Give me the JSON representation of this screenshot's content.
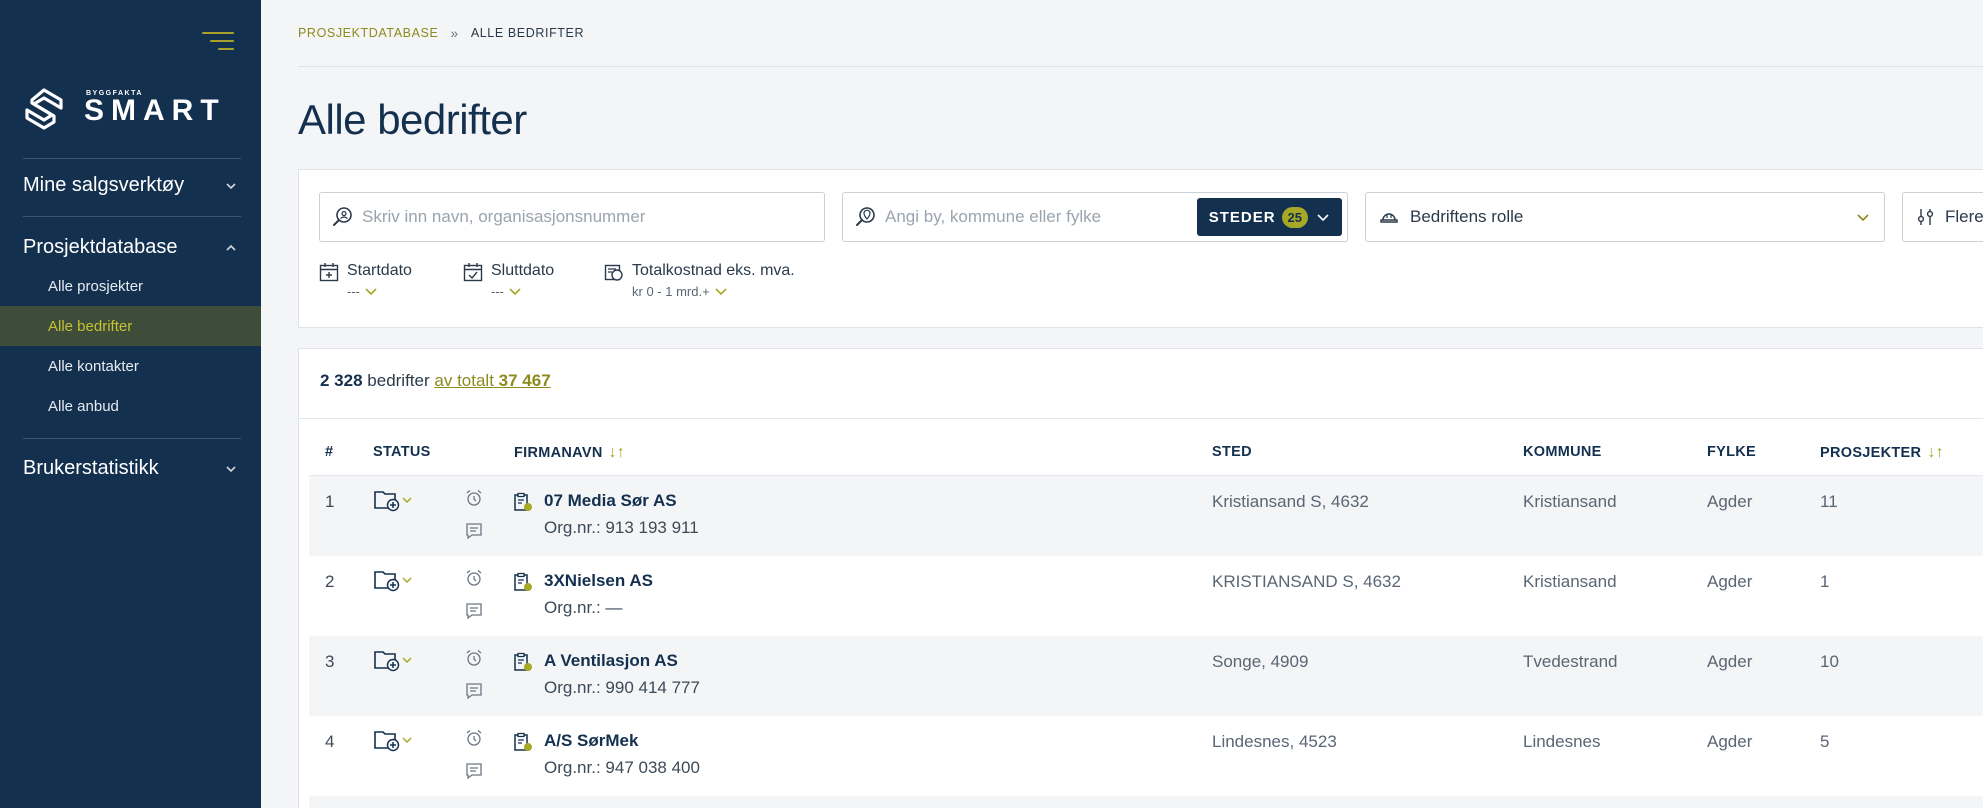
{
  "sidebar": {
    "logo_small": "BYGGFAKTA",
    "logo_big": "SMART",
    "sections": [
      {
        "label": "Mine salgsverktøy"
      },
      {
        "label": "Prosjektdatabase"
      },
      {
        "label": "Brukerstatistikk"
      }
    ],
    "items": [
      {
        "label": "Alle prosjekter"
      },
      {
        "label": "Alle bedrifter"
      },
      {
        "label": "Alle kontakter"
      },
      {
        "label": "Alle anbud"
      }
    ]
  },
  "breadcrumb": {
    "parent": "PROSJEKTDATABASE",
    "separator": "»",
    "current": "ALLE BEDRIFTER"
  },
  "page_title": "Alle bedrifter",
  "filters": {
    "name_placeholder": "Skriv inn navn, organisasjonsnummer",
    "place_placeholder": "Angi by, kommune eller fylke",
    "steder_label": "STEDER",
    "steder_count": "25",
    "role_label": "Bedriftens rolle",
    "more_label": "Flere",
    "startdato": {
      "label": "Startdato",
      "value": "---"
    },
    "sluttdato": {
      "label": "Sluttdato",
      "value": "---"
    },
    "totalkostnad": {
      "label": "Totalkostnad eks. mva.",
      "value": "kr 0 - 1 mrd.+"
    }
  },
  "results": {
    "count": "2 328",
    "count_label": "bedrifter",
    "total_prefix": "av totalt",
    "total": "37 467"
  },
  "table": {
    "headers": {
      "idx": "#",
      "status": "STATUS",
      "firmanavn": "FIRMANAVN",
      "sted": "STED",
      "kommune": "KOMMUNE",
      "fylke": "FYLKE",
      "prosjekter": "PROSJEKTER"
    },
    "rows": [
      {
        "idx": "1",
        "name": "07 Media Sør AS",
        "orgnr": "Org.nr.: 913 193 911",
        "sted": "Kristiansand S, 4632",
        "kommune": "Kristiansand",
        "fylke": "Agder",
        "prosjekter": "11"
      },
      {
        "idx": "2",
        "name": "3XNielsen AS",
        "orgnr": "Org.nr.: —",
        "sted": "KRISTIANSAND S, 4632",
        "kommune": "Kristiansand",
        "fylke": "Agder",
        "prosjekter": "1"
      },
      {
        "idx": "3",
        "name": "A Ventilasjon AS",
        "orgnr": "Org.nr.: 990 414 777",
        "sted": "Songe, 4909",
        "kommune": "Tvedestrand",
        "fylke": "Agder",
        "prosjekter": "10"
      },
      {
        "idx": "4",
        "name": "A/S SørMek",
        "orgnr": "Org.nr.: 947 038 400",
        "sted": "Lindesnes, 4523",
        "kommune": "Lindesnes",
        "fylke": "Agder",
        "prosjekter": "5"
      }
    ]
  },
  "colors": {
    "sidebar_bg": "#14304f",
    "accent": "#a6a826",
    "active_item_bg": "#3e4d3a"
  },
  "icons": [
    "menu-icon",
    "logo-icon",
    "chevron-down-icon",
    "chevron-up-icon",
    "search-icon",
    "location-search-icon",
    "helmet-icon",
    "sliders-icon",
    "calendar-start-icon",
    "calendar-end-icon",
    "cost-icon",
    "sort-icon",
    "folder-add-icon",
    "alarm-icon",
    "note-icon",
    "company-icon"
  ]
}
